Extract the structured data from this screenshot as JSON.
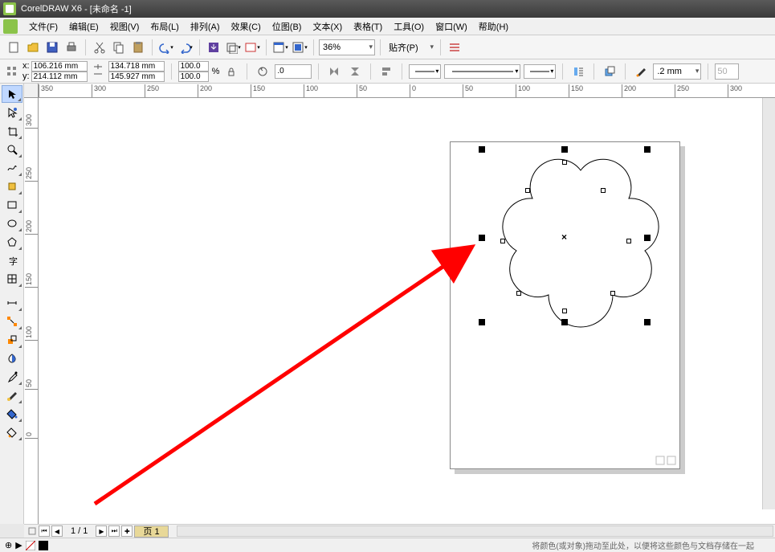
{
  "title": {
    "app": "CorelDRAW X6",
    "doc": "- [未命名 -1]"
  },
  "menu": [
    "文件(F)",
    "编辑(E)",
    "视图(V)",
    "布局(L)",
    "排列(A)",
    "效果(C)",
    "位图(B)",
    "文本(X)",
    "表格(T)",
    "工具(O)",
    "窗口(W)",
    "帮助(H)"
  ],
  "toolbar1": {
    "zoom": "36%",
    "snap": "贴齐(P)"
  },
  "props": {
    "x_label": "x:",
    "x": "106.216 mm",
    "y_label": "y:",
    "y": "214.112 mm",
    "w": "134.718 mm",
    "h": "145.927 mm",
    "sx": "100.0",
    "sy": "100.0",
    "pct": "%",
    "rotate": ".0",
    "outline": ".2 mm",
    "fontsize": "50"
  },
  "ruler_h": [
    "350",
    "300",
    "250",
    "200",
    "150",
    "100",
    "50",
    "0",
    "50",
    "100",
    "150",
    "200",
    "250",
    "300"
  ],
  "ruler_v": [
    "300",
    "250",
    "200",
    "150",
    "100",
    "50",
    "0"
  ],
  "pagenav": {
    "count": "1 / 1",
    "tab": "页 1"
  },
  "status": {
    "tip": "将颜色(或对象)拖动至此处，以便将这些颜色与文档存储在一起"
  }
}
